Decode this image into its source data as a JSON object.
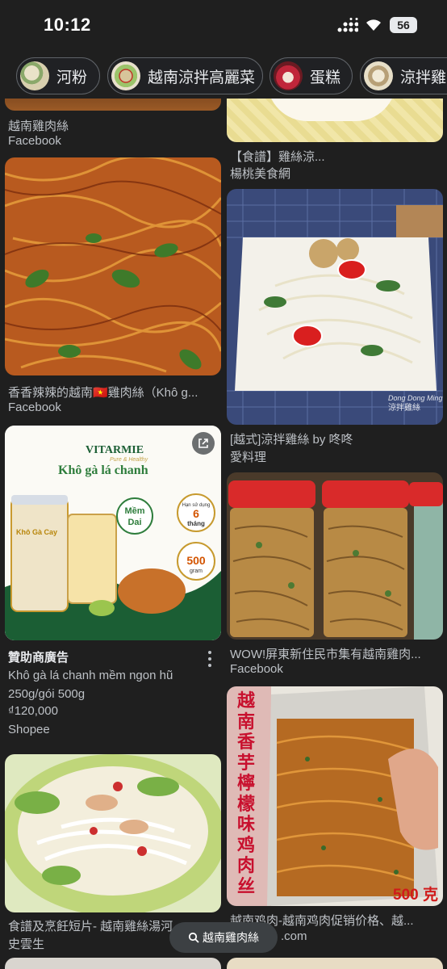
{
  "status": {
    "time": "10:12",
    "battery": "56"
  },
  "chips": [
    {
      "label": "河粉"
    },
    {
      "label": "越南涼拌高麗菜"
    },
    {
      "label": "蛋糕"
    },
    {
      "label": "涼拌雞"
    }
  ],
  "results": [
    {
      "caption": "越南雞肉絲",
      "source": "Facebook"
    },
    {
      "caption": "【食譜】雞絲涼...",
      "source": "楊桃美食網"
    },
    {
      "caption": "香香辣辣的越南🇻🇳雞肉絲（Khô g...",
      "source": "Facebook"
    },
    {
      "caption": "[越式]涼拌雞絲 by 咚咚",
      "source": "愛料理",
      "watermark": "Dong Dong Ming 涼拌雞絲"
    },
    {
      "caption": "WOW!屏東新住民市集有越南雞肉...",
      "source": "Facebook"
    },
    {
      "caption": "越南鸡肉-越南鸡肉促销价格、越...",
      "source": ".com",
      "overlay_text": [
        "越",
        "南",
        "香",
        "芋",
        "檸",
        "檬",
        "味",
        "鸡",
        "肉",
        "丝"
      ],
      "weight": "500 克"
    },
    {
      "caption": "食譜及烹飪短片- 越南雞絲湯河...",
      "source": "史雲生"
    }
  ],
  "ad": {
    "label": "贊助商廣告",
    "description": "Khô gà lá chanh mềm ngon hũ 250g/gói 500g",
    "price": "₫120,000",
    "source": "Shopee",
    "brand": "VITARMIE",
    "brand_sub": "Pure & Healthy",
    "headline": "Khô gà lá chanh",
    "badge_soft": [
      "Mềm",
      "Dai"
    ],
    "badge_expiry_top": "Hạn sử dụng",
    "badge_expiry_num": "6",
    "badge_expiry_unit": "tháng",
    "badge_weight_num": "500",
    "badge_weight_unit": "gram",
    "jar_label": "Khô Gà Cay"
  },
  "bottom_search": {
    "label": "越南雞肉絲"
  }
}
